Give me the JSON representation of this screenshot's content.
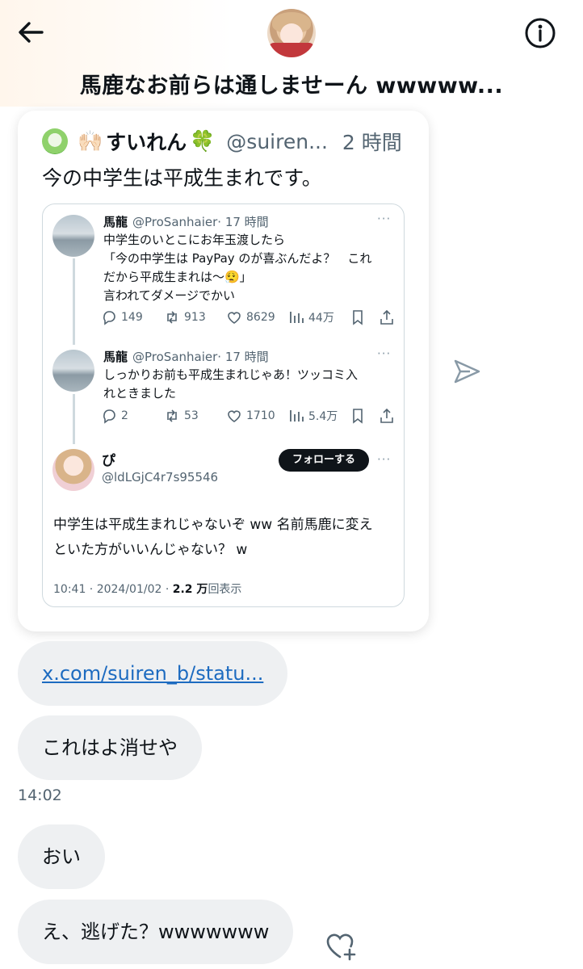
{
  "header": {
    "title": "馬鹿なお前らは通しませーん wwwww...",
    "back_icon": "arrow-left-icon",
    "info_icon": "info-icon"
  },
  "shared_tweet": {
    "emoji": "🙌🏻",
    "name": "すいれん",
    "name_emoji": "🍀",
    "handle": "@suiren...",
    "time": "2 時間",
    "text": "今の中学生は平成生まれです。",
    "quoted_thread": [
      {
        "name": "馬龍",
        "handle": "@ProSanhaier",
        "time": "· 17 時間",
        "more": "···",
        "body_lines": [
          "中学生のいとこにお年玉渡したら",
          "「今の中学生は PayPay のが喜ぶんだよ？　これ",
          "だから平成生まれは～😮‍💨」",
          "言われてダメージでかい"
        ],
        "replies": "149",
        "retweets": "913",
        "likes": "8629",
        "views": "44万"
      },
      {
        "name": "馬龍",
        "handle": "@ProSanhaier",
        "time": "· 17 時間",
        "more": "···",
        "body_lines": [
          "しっかりお前も平成生まれじゃあ！ツッコミ入",
          "れときました"
        ],
        "replies": "2",
        "retweets": "53",
        "likes": "1710",
        "views": "5.4万"
      }
    ],
    "main_post": {
      "name": "ぴ",
      "handle": "@ldLGjC4r7s95546",
      "follow_label": "フォローする",
      "more": "···",
      "body_lines": [
        "中学生は平成生まれじゃないぞ ww 名前馬鹿に変え",
        "といた方がいいんじゃない？ w"
      ],
      "time": "10:41 · 2024/01/02 · ",
      "views_count": "2.2 万",
      "views_label": "回表示"
    }
  },
  "messages": [
    {
      "text": "x.com/suiren_b/statu...",
      "is_link": true
    },
    {
      "text": "これはよ消せや"
    },
    {
      "text": "おい"
    },
    {
      "text": "え、逃げた？wwwwwww"
    }
  ],
  "message_time": "14:02",
  "icons": {
    "send": "send-icon",
    "react": "heart-plus-icon"
  }
}
